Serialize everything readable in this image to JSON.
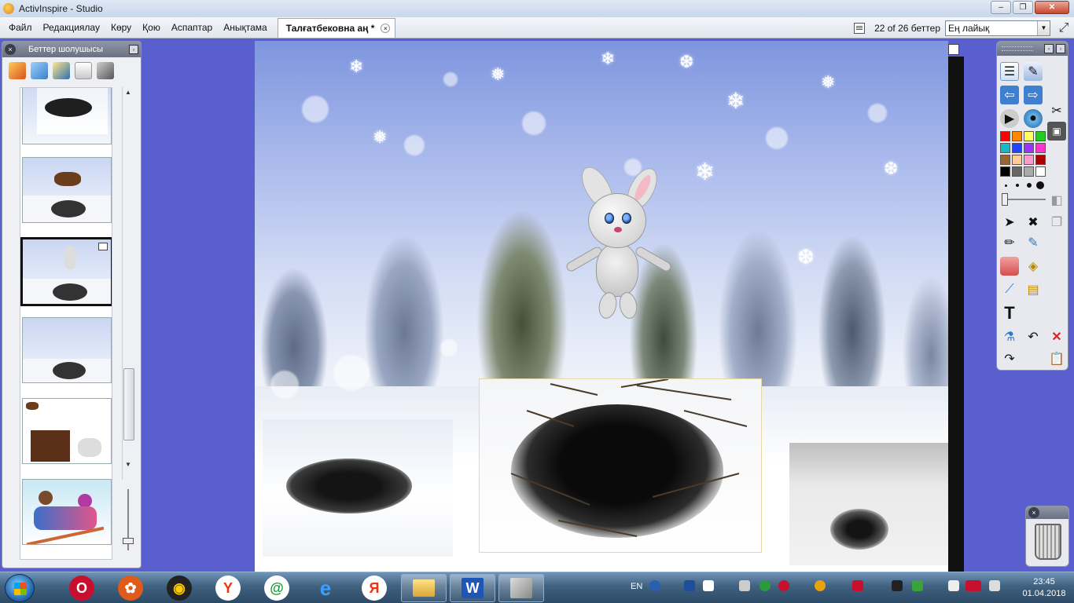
{
  "window": {
    "title": "ActivInspire - Studio",
    "buttons": {
      "minimize": "‒",
      "restore": "❐",
      "close": "✕"
    }
  },
  "menu": {
    "items": [
      "Файл",
      "Редакциялау",
      "Көру",
      "Қою",
      "Аспаптар",
      "Анықтама"
    ]
  },
  "document_tab": {
    "label": "Талғатбековна аң *",
    "close": "×"
  },
  "page_counter": "22 of 26 беттер",
  "zoom": {
    "selected": "Ең лайық"
  },
  "page_browser": {
    "title": "Беттер шолушысы",
    "thumbnails": [
      {
        "name": "page-thumb-burrow"
      },
      {
        "name": "page-thumb-bear"
      },
      {
        "name": "page-thumb-bunny-selected",
        "selected": true
      },
      {
        "name": "page-thumb-wolf"
      },
      {
        "name": "page-thumb-bear-bunny"
      },
      {
        "name": "page-thumb-skiers"
      }
    ]
  },
  "toolbox": {
    "colors": [
      "#ff0000",
      "#ff8800",
      "#ffff66",
      "#22cc22",
      "#11bbcc",
      "#2244ff",
      "#9933ff",
      "#ff33cc",
      "#996633",
      "#ffcc99",
      "#ff99cc",
      "#aa0000",
      "#000000",
      "#666666",
      "#aaaaaa",
      "#ffffff"
    ]
  },
  "taskbar": {
    "apps": [
      "opera",
      "media-player",
      "video-player",
      "yandex-browser",
      "mail-agent",
      "internet-explorer",
      "yandex"
    ],
    "windows": [
      "file-explorer",
      "word",
      "activinspire"
    ],
    "language": "EN",
    "time": "23:45",
    "date": "01.04.2018"
  }
}
